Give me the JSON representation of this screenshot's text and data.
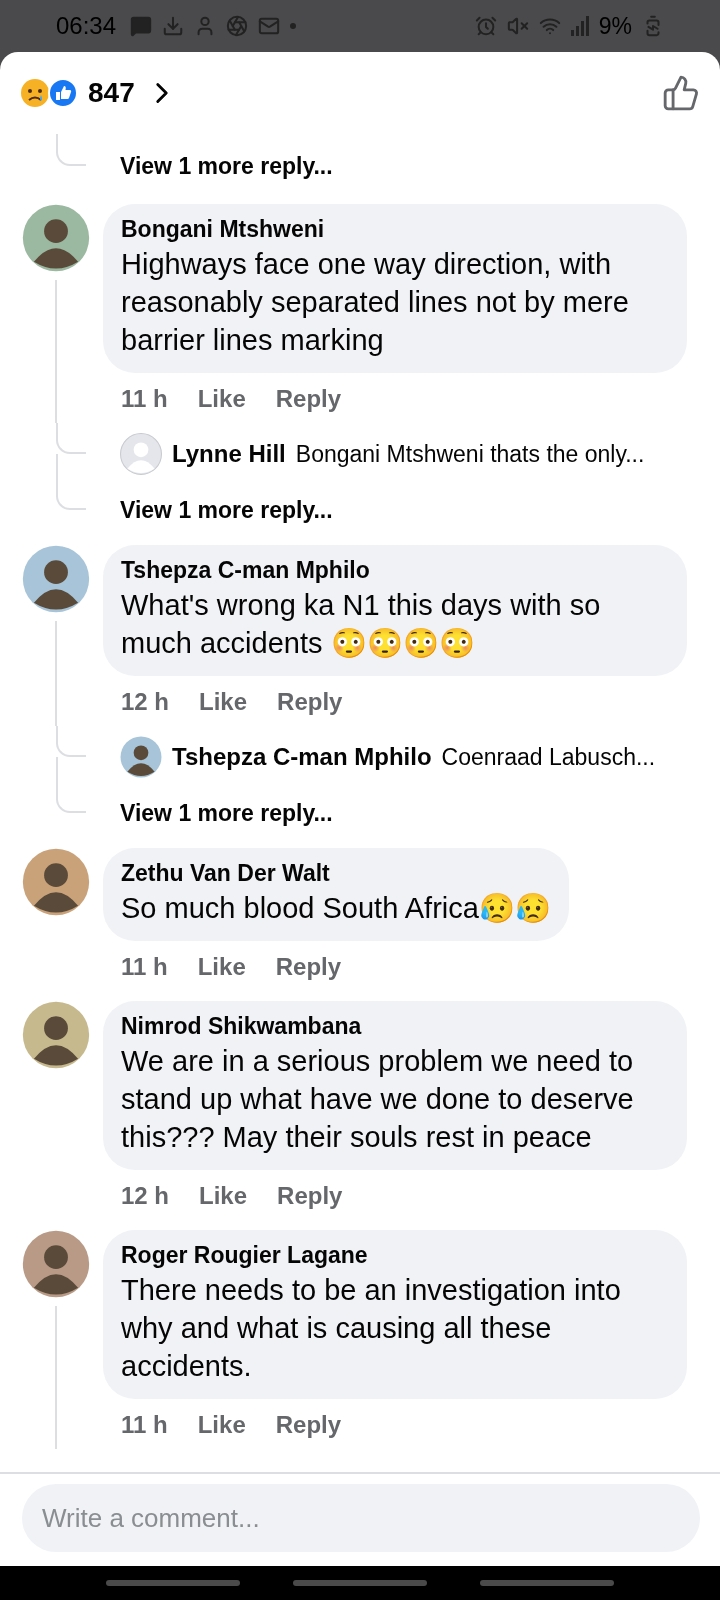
{
  "status_bar": {
    "time": "06:34",
    "battery": "9%"
  },
  "header": {
    "reaction_count": "847"
  },
  "top_thread": {
    "view_more": "View 1 more reply..."
  },
  "comments": [
    {
      "author": "Bongani Mtshweni",
      "avatar": {
        "kind": "photo"
      },
      "text": "Highways face one way direction, with reasonably separated lines not by mere barrier lines marking",
      "time": "11 h",
      "like": "Like",
      "reply": "Reply",
      "has_replies": true,
      "replies": [
        {
          "author": "Lynne Hill",
          "avatar": {
            "kind": "default"
          },
          "text": "Bongani Mtshweni thats the only..."
        }
      ],
      "view_more": "View 1 more reply..."
    },
    {
      "author": "Tshepza C-man Mphilo",
      "avatar": {
        "kind": "photo"
      },
      "text": "What's wrong ka N1 this days with so much accidents 😳😳😳😳",
      "time": "12 h",
      "like": "Like",
      "reply": "Reply",
      "has_replies": true,
      "replies": [
        {
          "author": "Tshepza C-man Mphilo",
          "avatar": {
            "kind": "photo"
          },
          "text": "Coenraad Labusch..."
        }
      ],
      "view_more": "View 1 more reply..."
    },
    {
      "author": "Zethu Van Der Walt",
      "avatar": {
        "kind": "photo"
      },
      "text": "So much blood South Africa😥😥",
      "time": "11 h",
      "like": "Like",
      "reply": "Reply",
      "has_replies": false
    },
    {
      "author": "Nimrod Shikwambana",
      "avatar": {
        "kind": "photo"
      },
      "text": "We are in a serious problem we need to stand up what have we done to deserve this??? May their souls rest in peace",
      "time": "12 h",
      "like": "Like",
      "reply": "Reply",
      "has_replies": false
    },
    {
      "author": "Roger Rougier Lagane",
      "avatar": {
        "kind": "photo"
      },
      "text": "There needs to be an investigation into why and what is causing all these accidents.",
      "time": "11 h",
      "like": "Like",
      "reply": "Reply",
      "has_replies": true
    }
  ],
  "composer": {
    "placeholder": "Write a comment..."
  }
}
